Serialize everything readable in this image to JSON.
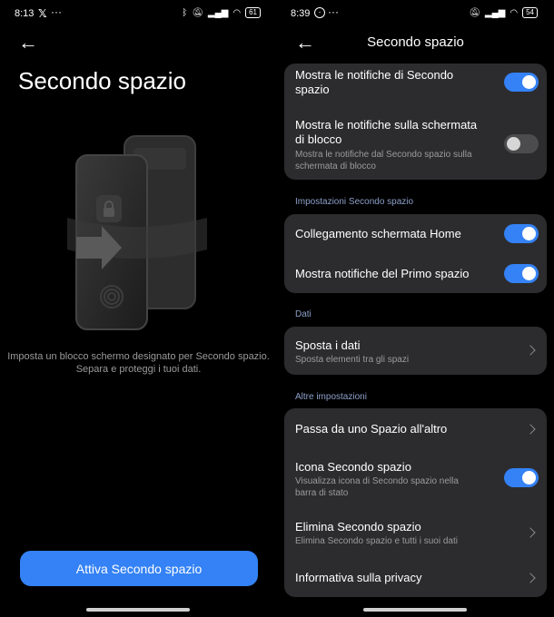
{
  "left": {
    "status": {
      "time": "8:13",
      "battery": "61"
    },
    "title": "Secondo spazio",
    "description_line1": "Imposta un blocco schermo designato per Secondo spazio.",
    "description_line2": "Separa e proteggi i tuoi dati.",
    "button_label": "Attiva Secondo spazio"
  },
  "right": {
    "status": {
      "time": "8:39",
      "battery": "54"
    },
    "title": "Secondo spazio",
    "card1": {
      "row1": {
        "title_line1": "Mostra le notifiche di Secondo",
        "title_line2": "spazio",
        "toggle": "on"
      },
      "row2": {
        "title_line1": "Mostra le notifiche sulla schermata",
        "title_line2": "di blocco",
        "subtitle_line1": "Mostra le notifiche dal Secondo spazio sulla",
        "subtitle_line2": "schermata di blocco",
        "toggle": "off"
      }
    },
    "section_impostazioni": "Impostazioni Secondo spazio",
    "card2": {
      "row1": {
        "title": "Collegamento schermata Home",
        "toggle": "on"
      },
      "row2": {
        "title": "Mostra notifiche del Primo spazio",
        "toggle": "on"
      }
    },
    "section_dati": "Dati",
    "card3": {
      "row1": {
        "title": "Sposta i dati",
        "subtitle": "Sposta elementi tra gli spazi"
      }
    },
    "section_altre": "Altre impostazioni",
    "card4": {
      "row1": {
        "title": "Passa da uno Spazio all'altro"
      },
      "row2": {
        "title": "Icona Secondo spazio",
        "subtitle_line1": "Visualizza icona di Secondo spazio nella",
        "subtitle_line2": "barra di stato",
        "toggle": "on"
      },
      "row3": {
        "title": "Elimina Secondo spazio",
        "subtitle": "Elimina Secondo spazio e tutti i suoi dati"
      },
      "row4": {
        "title": "Informativa sulla privacy"
      }
    }
  },
  "colors": {
    "accent": "#3482f5",
    "card": "#2c2c2e",
    "section": "#8ca0c9",
    "background": "#000000"
  },
  "icons": [
    "back-arrow-icon",
    "chevron-right-icon",
    "bluetooth-icon",
    "mute-icon",
    "signal-icon",
    "wifi-icon",
    "battery-icon",
    "x-app-icon",
    "lock-icon",
    "fingerprint-icon",
    "arrow-right-icon"
  ]
}
